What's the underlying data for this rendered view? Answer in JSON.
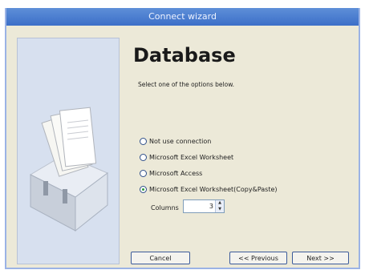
{
  "window": {
    "title": "Connect wizard"
  },
  "main": {
    "heading": "Database",
    "subtext": "Select one of the options below.",
    "options": [
      {
        "label": "Not use connection",
        "selected": false
      },
      {
        "label": "Microsoft Excel Worksheet",
        "selected": false
      },
      {
        "label": "Microsoft Access",
        "selected": false
      },
      {
        "label": "Microsoft Excel Worksheet(Copy&Paste)",
        "selected": true
      }
    ],
    "columns_label": "Columns",
    "columns_value": "3"
  },
  "buttons": {
    "cancel": "Cancel",
    "previous": "<< Previous",
    "next": "Next >>"
  }
}
